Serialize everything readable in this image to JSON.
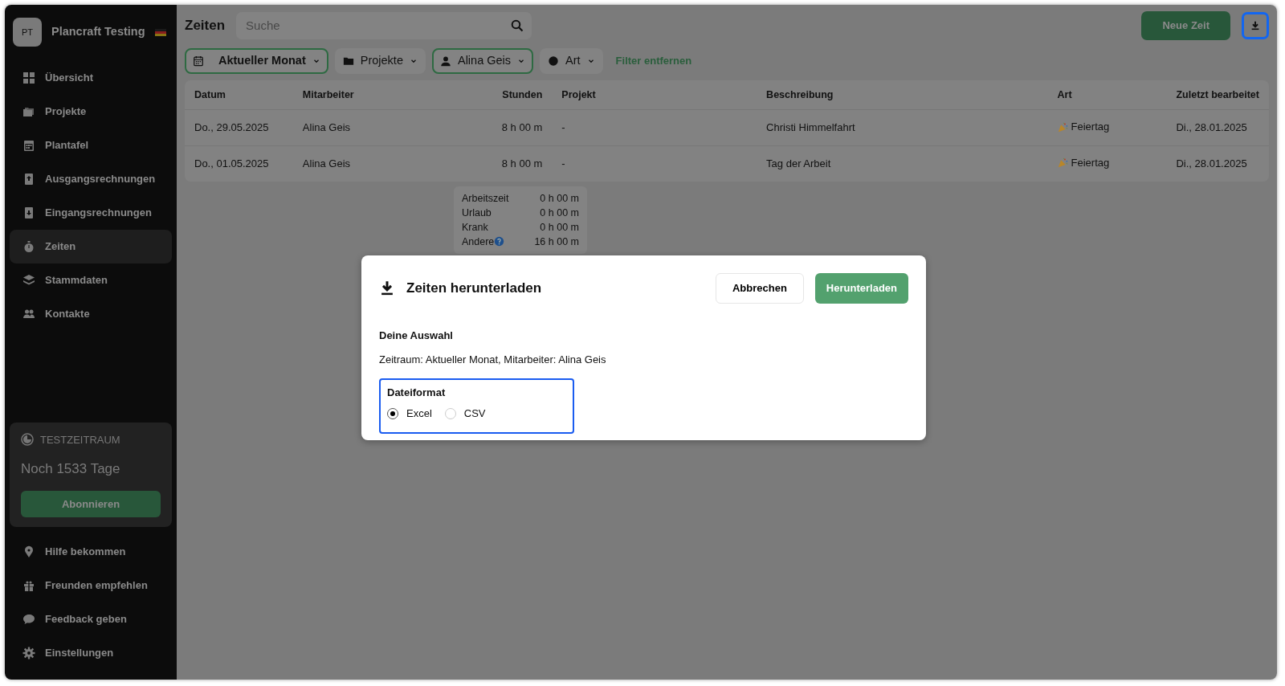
{
  "sidebar": {
    "workspace": {
      "initials": "PT",
      "name": "Plancraft Testing"
    },
    "nav": [
      {
        "label": "Übersicht",
        "selected": false
      },
      {
        "label": "Projekte",
        "selected": false
      },
      {
        "label": "Plantafel",
        "selected": false
      },
      {
        "label": "Ausgangsrechnungen",
        "selected": false
      },
      {
        "label": "Eingangsrechnungen",
        "selected": false
      },
      {
        "label": "Zeiten",
        "selected": true
      },
      {
        "label": "Stammdaten",
        "selected": false
      },
      {
        "label": "Kontakte",
        "selected": false
      }
    ],
    "trial": {
      "label": "TESTZEITRAUM",
      "remaining": "Noch 1533 Tage",
      "button": "Abonnieren"
    },
    "footer": [
      {
        "label": "Hilfe bekommen"
      },
      {
        "label": "Freunden empfehlen"
      },
      {
        "label": "Feedback geben"
      },
      {
        "label": "Einstellungen"
      }
    ]
  },
  "header": {
    "title": "Zeiten",
    "search": {
      "placeholder": "Suche"
    },
    "new_button": "Neue Zeit",
    "download_focused": true
  },
  "filters": [
    {
      "label": "Aktueller Monat",
      "active": true
    },
    {
      "label": "Projekte",
      "active": false
    },
    {
      "label": "Alina Geis",
      "active": true
    },
    {
      "label": "Art",
      "active": false
    }
  ],
  "clear_filters": "Filter entfernen",
  "table": {
    "columns": [
      "Datum",
      "Mitarbeiter",
      "Stunden",
      "Projekt",
      "Beschreibung",
      "Art",
      "Zuletzt bearbeitet"
    ],
    "rows": [
      [
        "Do., 29.05.2025",
        "Alina Geis",
        "8 h 00 m",
        "-",
        "Christi Himmelfahrt",
        "Feiertag",
        "Di., 28.01.2025"
      ],
      [
        "Do., 01.05.2025",
        "Alina Geis",
        "8 h 00 m",
        "-",
        "Tag der Arbeit",
        "Feiertag",
        "Di., 28.01.2025"
      ]
    ]
  },
  "summary": [
    {
      "label": "Arbeitszeit",
      "value": "0 h 00 m",
      "help": false
    },
    {
      "label": "Urlaub",
      "value": "0 h 00 m",
      "help": false
    },
    {
      "label": "Krank",
      "value": "0 h 00 m",
      "help": false
    },
    {
      "label": "Andere",
      "value": "16 h 00 m",
      "help": true
    }
  ],
  "modal": {
    "title": "Zeiten herunterladen",
    "cancel": "Abbrechen",
    "confirm": "Herunterladen",
    "selection_heading": "Deine Auswahl",
    "selection_text": "Zeitraum: Aktueller Monat, Mitarbeiter: Alina Geis",
    "format_label": "Dateiformat",
    "format_focused": true,
    "options": [
      {
        "label": "Excel",
        "selected": true
      },
      {
        "label": "CSV",
        "selected": false
      }
    ]
  }
}
